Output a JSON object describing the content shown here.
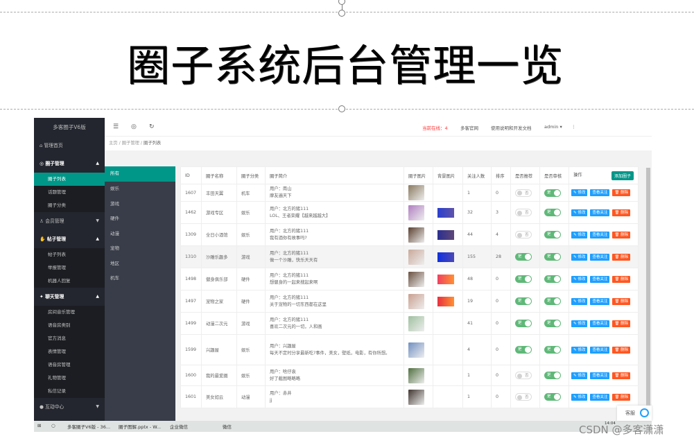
{
  "slide": {
    "title": "圈子系统后台管理一览"
  },
  "sidebar": {
    "logo": "多客圈子V6版",
    "items": [
      {
        "label": "管理首页",
        "icon": "home-icon"
      },
      {
        "label": "圈子管理",
        "icon": "circle-icon",
        "open": true,
        "children": [
          "圈子列表",
          "话题管理",
          "圈子分类"
        ]
      },
      {
        "label": "会员管理",
        "icon": "user-icon"
      },
      {
        "label": "帖子管理",
        "icon": "post-icon",
        "open": true,
        "children": [
          "帖子列表",
          "举报管理",
          "机器人回复"
        ]
      },
      {
        "label": "聊天管理",
        "icon": "chat-icon",
        "open": true,
        "children": [
          "房间音乐管理",
          "语音房类别",
          "官方消息",
          "表情管理",
          "语音房管理",
          "礼物管理",
          "私信记录"
        ]
      },
      {
        "label": "互动中心",
        "icon": "interact-icon"
      }
    ]
  },
  "topbar": {
    "online_label": "当前在线：4",
    "site": "多客官网",
    "docs": "使用说明和开发文档",
    "user": "admin"
  },
  "breadcrumb": [
    "主页",
    "圈子管理",
    "圈子列表"
  ],
  "categories": [
    "所有",
    "娱乐",
    "游戏",
    "硬件",
    "动漫",
    "宠物",
    "地区",
    "机车"
  ],
  "table": {
    "headers": [
      "ID",
      "圈子名称",
      "圈子分类",
      "圈子简介",
      "圈子图片",
      "背景图片",
      "关注人数",
      "排序",
      "是否推荐",
      "是否审核",
      "操作"
    ],
    "add_label": "添加圈子",
    "actions": {
      "edit": "修改",
      "view": "查看关注",
      "delete": "删除"
    },
    "switch_on": "是",
    "switch_off": "否",
    "rows": [
      {
        "id": "1607",
        "name": "丰田天翼",
        "cat": "机车",
        "user": "用户：南山",
        "desc": "摩友遍天下",
        "followers": "1",
        "sort": "0",
        "recommend": false,
        "audit": true,
        "img": "#8a7a60",
        "bg": null
      },
      {
        "id": "1462",
        "name": "游戏专区",
        "cat": "娱乐",
        "user": "用户：北方的猪111",
        "desc": "LOL、王者荣耀【越来越越大】",
        "followers": "32",
        "sort": "3",
        "recommend": false,
        "audit": true,
        "img": "#b07fc0",
        "bg": "#2a3fd0"
      },
      {
        "id": "1309",
        "name": "全日小酒馆",
        "cat": "娱乐",
        "user": "用户：北方的猪111",
        "desc": "我有酒你有故事吗?",
        "followers": "44",
        "sort": "4",
        "recommend": false,
        "audit": true,
        "img": "#5a4030",
        "bg": "#2a2f90"
      },
      {
        "id": "1310",
        "name": "沙雕乐趣多",
        "cat": "游戏",
        "user": "用户：北方的猪111",
        "desc": "做一个沙雕，快乐天天有",
        "followers": "155",
        "sort": "28",
        "recommend": true,
        "audit": true,
        "img": "#c9a99a",
        "bg": "#1030e0"
      },
      {
        "id": "1498",
        "name": "健身俱乐部",
        "cat": "硬件",
        "user": "用户：北方的猪111",
        "desc": "想健身的一起来搜起来啊",
        "followers": "48",
        "sort": "0",
        "recommend": true,
        "audit": true,
        "img": "#6a5040",
        "bg": "#f04060"
      },
      {
        "id": "1497",
        "name": "宠物之家",
        "cat": "硬件",
        "user": "用户：北方的猪111",
        "desc": "关于宠物的一切东西都在这里",
        "followers": "19",
        "sort": "0",
        "recommend": true,
        "audit": true,
        "img": "#c9a090",
        "bg": "#e83040"
      },
      {
        "id": "1499",
        "name": "动漫二次元",
        "cat": "游戏",
        "user": "用户：北方的猪111",
        "desc": "喜欢二次元的一切，人和画",
        "followers": "41",
        "sort": "0",
        "recommend": true,
        "audit": true,
        "img": "#a0c0a0",
        "bg": null
      },
      {
        "id": "1599",
        "name": "兴趣屋",
        "cat": "娱乐",
        "user": "用户：兴趣屋",
        "desc": "每天不定时分享最新吃?事件，美女，壁纸，电影，有你所想。",
        "followers": "4",
        "sort": "0",
        "recommend": true,
        "audit": true,
        "img": "#7090c0",
        "bg": null
      },
      {
        "id": "1600",
        "name": "我的最爱圈",
        "cat": "娱乐",
        "user": "用户：啥仔袁",
        "desc": "好了截图略略略",
        "followers": "1",
        "sort": "0",
        "recommend": false,
        "audit": true,
        "img": "#507040",
        "bg": null
      },
      {
        "id": "1601",
        "name": "美女如云",
        "cat": "动漫",
        "user": "用户：赤井",
        "desc": "jj",
        "followers": "1",
        "sort": "0",
        "recommend": false,
        "audit": true,
        "img": "#403530",
        "bg": null
      }
    ]
  },
  "taskbar": {
    "apps": [
      "多客圈子V6版 - 36...",
      "圈子图解.pptx - W...",
      "企业微信",
      "微信"
    ],
    "time": "14:04"
  },
  "kefu": "客服",
  "watermark": "CSDN @多客潇潇"
}
